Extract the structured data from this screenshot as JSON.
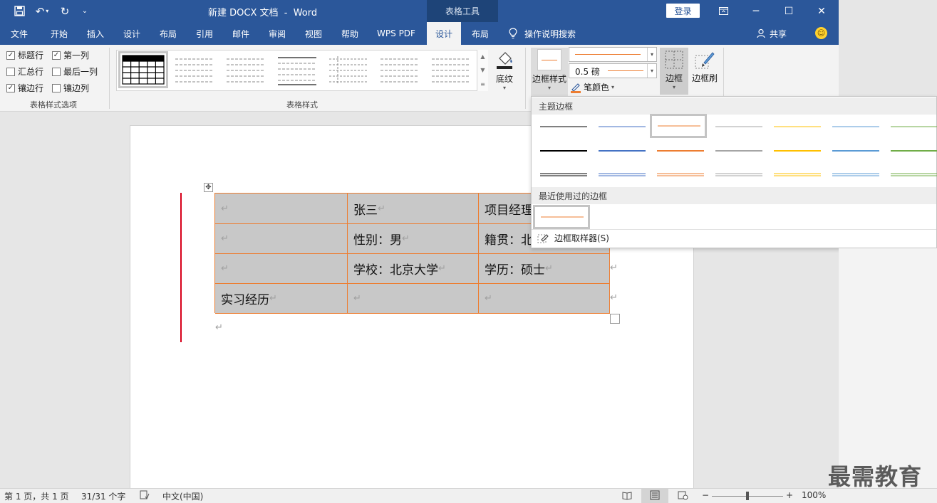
{
  "window": {
    "title": "新建 DOCX 文档  -  Word",
    "context_tab": "表格工具",
    "login": "登录"
  },
  "tabs": [
    {
      "label": "文件"
    },
    {
      "label": "开始"
    },
    {
      "label": "插入"
    },
    {
      "label": "设计"
    },
    {
      "label": "布局"
    },
    {
      "label": "引用"
    },
    {
      "label": "邮件"
    },
    {
      "label": "审阅"
    },
    {
      "label": "视图"
    },
    {
      "label": "帮助"
    },
    {
      "label": "WPS PDF"
    },
    {
      "label": "设计"
    },
    {
      "label": "布局"
    }
  ],
  "tell_me": "操作说明搜索",
  "share": "共享",
  "ribbon": {
    "style_options": {
      "label": "表格样式选项",
      "items": [
        {
          "label": "标题行",
          "checked": true
        },
        {
          "label": "第一列",
          "checked": true
        },
        {
          "label": "汇总行",
          "checked": false
        },
        {
          "label": "最后一列",
          "checked": false
        },
        {
          "label": "镶边行",
          "checked": true
        },
        {
          "label": "镶边列",
          "checked": false
        }
      ]
    },
    "table_styles": {
      "label": "表格样式"
    },
    "shading": "底纹",
    "border_style": "边框样式",
    "pen_weight": "0.5 磅",
    "pen_color": "笔颜色",
    "borders": "边框",
    "border_painter": "边框刷"
  },
  "colors": {
    "accent_blue": "#2b579a",
    "table_border": "#ed7d31",
    "cell_shading": "#c8c8c8",
    "theme_lines": [
      "#000000",
      "#4472c4",
      "#ed7d31",
      "#a5a5a5",
      "#ffc000",
      "#5b9bd5",
      "#70ad47"
    ]
  },
  "document": {
    "table": [
      [
        "",
        "张三",
        "项目经理"
      ],
      [
        "",
        "性别：男",
        "籍贯：北"
      ],
      [
        "",
        "学校：北京大学",
        "学历：硕士"
      ],
      [
        "实习经历",
        "",
        ""
      ]
    ],
    "paragraph_mark": "↵"
  },
  "dropdown": {
    "theme_borders": "主题边框",
    "recent_borders": "最近使用过的边框",
    "sampler": "边框取样器(S)"
  },
  "statusbar": {
    "page": "第 1 页，共 1 页",
    "words": "31/31 个字",
    "language": "中文(中国)",
    "zoom": "100%"
  },
  "watermark": "最需教育"
}
